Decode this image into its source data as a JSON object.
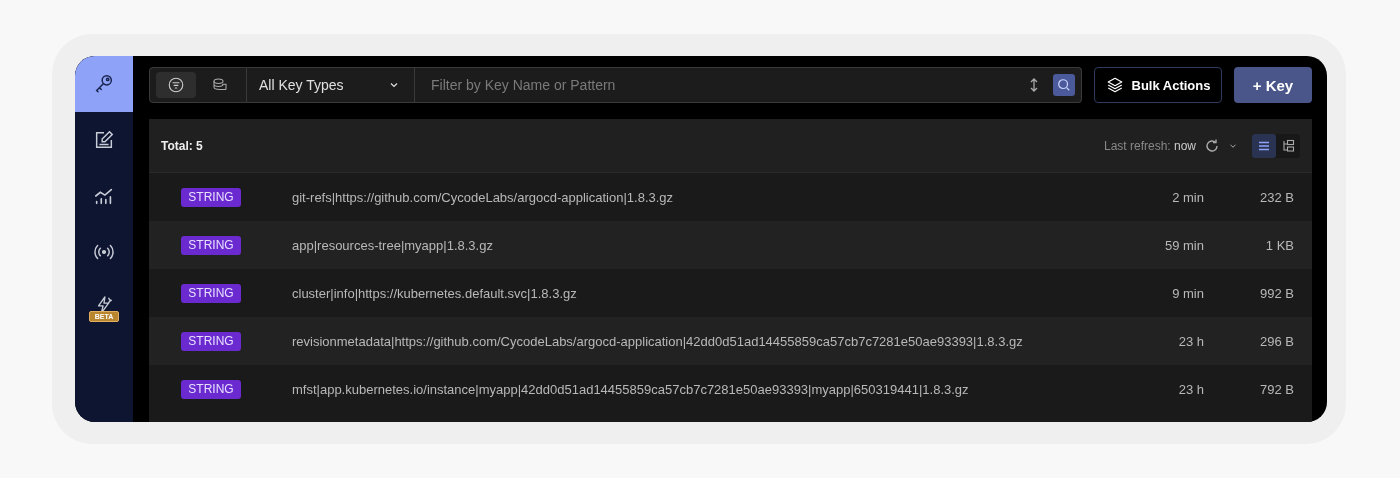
{
  "sidebar": {
    "items": [
      {
        "kind": "key",
        "selected": true
      },
      {
        "kind": "edit",
        "selected": false
      },
      {
        "kind": "analytics",
        "selected": false
      },
      {
        "kind": "broadcast",
        "selected": false
      },
      {
        "kind": "bolt",
        "selected": false,
        "badge": "BETA"
      }
    ]
  },
  "toolbar": {
    "modes": [
      {
        "kind": "filter",
        "selected": true
      },
      {
        "kind": "database",
        "selected": false
      }
    ],
    "key_type": "All Key Types",
    "search": {
      "placeholder": "Filter by Key Name or Pattern"
    },
    "bulk_button": "Bulk Actions",
    "add_button": "+ Key"
  },
  "list_header": {
    "total": "Total: 5",
    "refresh_label": "Last refresh:",
    "refresh_value": "now",
    "views": [
      {
        "kind": "list",
        "selected": true
      },
      {
        "kind": "tree",
        "selected": false
      }
    ]
  },
  "rows": [
    {
      "type": "STRING",
      "key": "git-refs|https://github.com/CycodeLabs/argocd-application|1.8.3.gz",
      "ttl": "2 min",
      "size": "232 B"
    },
    {
      "type": "STRING",
      "key": "app|resources-tree|myapp|1.8.3.gz",
      "ttl": "59 min",
      "size": "1 KB"
    },
    {
      "type": "STRING",
      "key": "cluster|info|https://kubernetes.default.svc|1.8.3.gz",
      "ttl": "9 min",
      "size": "992 B"
    },
    {
      "type": "STRING",
      "key": "revisionmetadata|https://github.com/CycodeLabs/argocd-application|42dd0d51ad14455859ca57cb7c7281e50ae93393|1.8.3.gz",
      "ttl": "23 h",
      "size": "296 B"
    },
    {
      "type": "STRING",
      "key": "mfst|app.kubernetes.io/instance|myapp|42dd0d51ad14455859ca57cb7c7281e50ae93393|myapp|650319441|1.8.3.gz",
      "ttl": "23 h",
      "size": "792 B"
    }
  ]
}
